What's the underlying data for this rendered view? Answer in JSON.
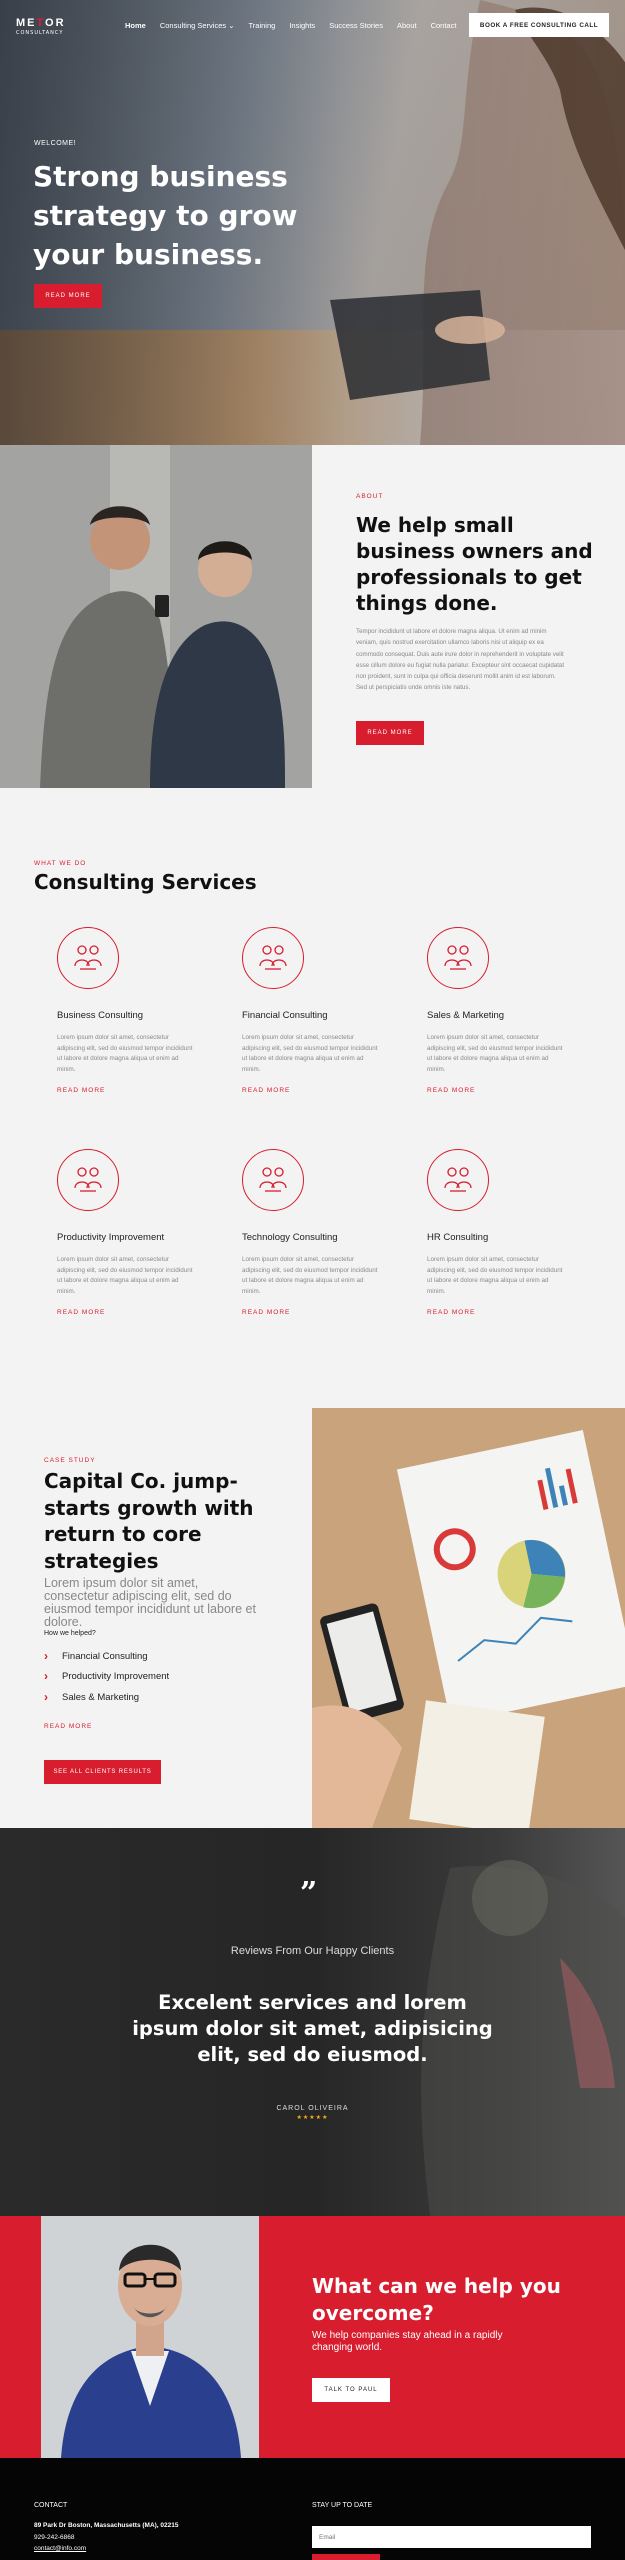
{
  "header": {
    "logo_text_a": "ME",
    "logo_text_b": "T",
    "logo_text_c": "OR",
    "logo_sub": "CONSULTANCY",
    "nav": [
      {
        "label": "Home"
      },
      {
        "label": "Consulting Services ⌄"
      },
      {
        "label": "Training"
      },
      {
        "label": "Insights"
      },
      {
        "label": "Success Stories"
      },
      {
        "label": "About"
      },
      {
        "label": "Contact"
      }
    ],
    "cta_label": "BOOK A FREE CONSULTING CALL"
  },
  "hero": {
    "welcome": "WELCOME!",
    "title": "Strong business strategy to grow your business.",
    "button": "READ MORE"
  },
  "about": {
    "eyebrow": "ABOUT",
    "title": "We help small business owners and professionals to get things done.",
    "body": "Tempor incididunt ut labore et dolore magna aliqua. Ut enim ad minim veniam, quis nostrud exercitation ullamco laboris nisi ut aliquip ex ea commodo consequat. Duis aute irure dolor in reprehenderit in voluptate velit esse cillum dolore eu fugiat nulla pariatur. Excepteur sint occaecat cupidatat non proident, sunt in culpa qui officia deserunt mollit anim id est laborum. Sed ut perspiciatis unde omnis iste natus.",
    "button": "READ MORE"
  },
  "services": {
    "eyebrow": "WHAT WE DO",
    "title": "Consulting Services",
    "items": [
      {
        "name": "Business Consulting",
        "desc": "Lorem ipsum dolor sit amet, consectetur adipiscing elit, sed do eiusmod tempor incididunt ut labore et dolore magna aliqua ut enim ad minim.",
        "more": "READ MORE"
      },
      {
        "name": "Financial Consulting",
        "desc": "Lorem ipsum dolor sit amet, consectetur adipiscing elit, sed do eiusmod tempor incididunt ut labore et dolore magna aliqua ut enim ad minim.",
        "more": "READ MORE"
      },
      {
        "name": "Sales & Marketing",
        "desc": "Lorem ipsum dolor sit amet, consectetur adipiscing elit, sed do eiusmod tempor incididunt ut labore et dolore magna aliqua ut enim ad minim.",
        "more": "READ MORE"
      },
      {
        "name": "Productivity Improvement",
        "desc": "Lorem ipsum dolor sit amet, consectetur adipiscing elit, sed do eiusmod tempor incididunt ut labore et dolore magna aliqua ut enim ad minim.",
        "more": "READ MORE"
      },
      {
        "name": "Technology Consulting",
        "desc": "Lorem ipsum dolor sit amet, consectetur adipiscing elit, sed do eiusmod tempor incididunt ut labore et dolore magna aliqua ut enim ad minim.",
        "more": "READ MORE"
      },
      {
        "name": "HR Consulting",
        "desc": "Lorem ipsum dolor sit amet, consectetur adipiscing elit, sed do eiusmod tempor incididunt ut labore et dolore magna aliqua ut enim ad minim.",
        "more": "READ MORE"
      }
    ]
  },
  "case_study": {
    "eyebrow": "CASE STUDY",
    "title": "Capital Co. jump-starts growth with return to core strategies",
    "subtitle": "Lorem ipsum dolor sit amet, consectetur adipiscing elit, sed do eiusmod tempor incididunt ut labore et dolore.",
    "helped_label": "How we helped?",
    "items": [
      "Financial Consulting",
      "Productivity Improvement",
      "Sales & Marketing"
    ],
    "read_more": "READ MORE",
    "button": "SEE ALL CLIENTS RESULTS"
  },
  "testimonial": {
    "quote_mark": "”",
    "label": "Reviews From Our Happy Clients",
    "quote": "Excelent services and lorem ipsum dolor sit amet, adipisicing elit, sed do eiusmod.",
    "author": "CAROL OLIVEIRA",
    "stars": "★★★★★",
    "rating": 5
  },
  "cta": {
    "title": "What can we help you overcome?",
    "body": "We help companies stay ahead in a rapidly changing world.",
    "button": "TALK TO PAUL"
  },
  "footer": {
    "contact_heading": "CONTACT",
    "address": "89 Park Dr Boston, Massachusetts (MA), 02215",
    "phone": "929-242-6868",
    "email": "contact@info.com",
    "stay_heading": "STAY UP TO DATE",
    "email_placeholder": "Email"
  },
  "colors": {
    "accent": "#d81d2f",
    "footer_bg": "#050505",
    "star": "#f2b01e"
  }
}
